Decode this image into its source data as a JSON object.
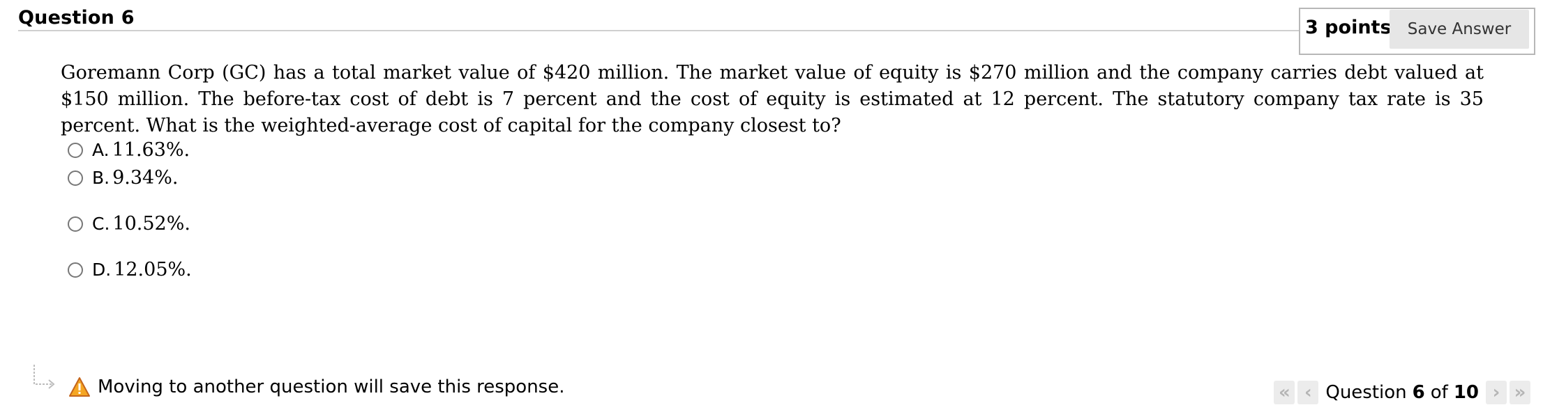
{
  "header": {
    "title": "Question 6",
    "points": "3 points",
    "save_label": "Save Answer"
  },
  "question": {
    "text": "Goremann Corp (GC) has a total market value of $420 million. The market value of equity is $270 million and the company carries debt valued at $150 million. The before-tax cost of debt is 7 percent and the cost of equity is estimated at 12 percent. The statutory company tax rate is 35 percent. What is the weighted-average cost of capital for the company closest to?"
  },
  "options": [
    {
      "letter": "A.",
      "text": "11.63%."
    },
    {
      "letter": "B.",
      "text": "9.34%."
    },
    {
      "letter": "C.",
      "text": "10.52%."
    },
    {
      "letter": "D.",
      "text": "12.05%."
    }
  ],
  "footer": {
    "warning": "Moving to another question will save this response.",
    "pager_word": "Question",
    "current": "6",
    "of_word": "of",
    "total": "10"
  },
  "icons": {
    "warning": "warning-triangle-icon",
    "first": "double-chevron-left-icon",
    "prev": "chevron-left-icon",
    "next": "chevron-right-icon",
    "last": "double-chevron-right-icon"
  },
  "colors": {
    "warning_fill": "#f5a623",
    "button_bg": "#e6e6e6",
    "rule": "#cfcfcf"
  }
}
